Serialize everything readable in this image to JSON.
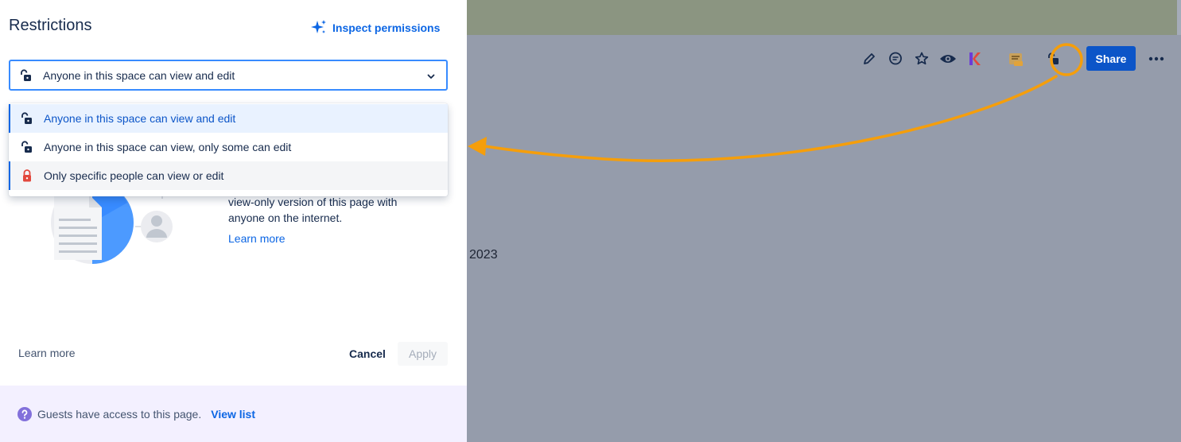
{
  "panel": {
    "title": "Restrictions",
    "inspect_label": "Inspect permissions",
    "select_value": "Anyone in this space can view and edit",
    "options": [
      {
        "label": "Anyone in this space can view and edit",
        "icon": "unlock-icon"
      },
      {
        "label": "Anyone in this space can view, only some can edit",
        "icon": "unlock-icon"
      },
      {
        "label": "Only specific people can view or edit",
        "icon": "lock-red-icon"
      }
    ],
    "share_text": "view-only version of this page with anyone on the internet.",
    "share_learn_more": "Learn more",
    "footer_learn_more": "Learn more",
    "cancel_label": "Cancel",
    "apply_label": "Apply",
    "guest_text": "Guests have access to this page.",
    "view_list_label": "View list"
  },
  "background": {
    "share_label": "Share",
    "year_text": "2023",
    "toolbar_icons": [
      "pencil-icon",
      "comment-icon",
      "star-icon",
      "watch-eye-icon",
      "k-app-icon",
      "new-badge-icon",
      "restrictions-unlock-icon"
    ]
  },
  "colors": {
    "accent": "#0c66e4",
    "share_button": "#0c55c8",
    "annotation": "#f59e0b",
    "restricted_lock": "#e2483d",
    "guest_bar": "#f3f0ff"
  }
}
